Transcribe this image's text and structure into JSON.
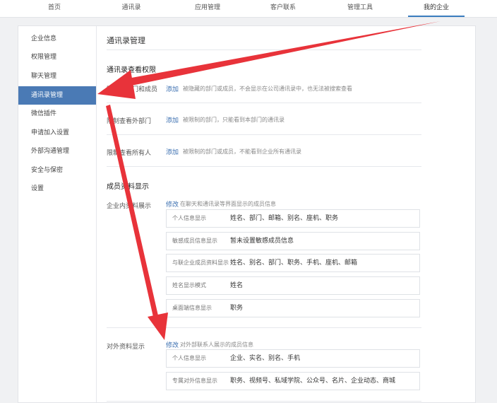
{
  "topnav": [
    "首页",
    "通讯录",
    "应用管理",
    "客户联系",
    "管理工具",
    "我的企业"
  ],
  "sidebar": [
    "企业信息",
    "权限管理",
    "聊天管理",
    "通讯录管理",
    "微信插件",
    "申请加入设置",
    "外部沟通管理",
    "安全与保密",
    "设置"
  ],
  "main": {
    "title": "通讯录管理",
    "view_perm": {
      "title": "通讯录查看权限",
      "rows": [
        {
          "label": "隐藏的部门和成员",
          "link": "添加",
          "desc": "被隐藏的部门或成员，不会显示在公司通讯录中，也无法被搜索查看"
        },
        {
          "label": "限制查看外部门",
          "link": "添加",
          "desc": "被限制的部门，只能看到本部门的通讯录"
        },
        {
          "label": "限制查看所有人",
          "link": "添加",
          "desc": "被限制的部门或成员，不能看到企业所有通讯录"
        }
      ]
    },
    "member_display": {
      "title": "成员资料显示",
      "internal": {
        "label": "企业内资料展示",
        "link": "修改",
        "desc": "在聊天和通讯录等界面显示的成员信息",
        "boxes": [
          {
            "k": "个人信息显示",
            "v": "姓名、部门、邮箱、别名、座机、职务"
          },
          {
            "k": "敏感成员信息显示",
            "v": "暂未设置敏感成员信息"
          },
          {
            "k": "与联企业成员资料显示",
            "v": "姓名、别名、部门、职务、手机、座机、邮箱"
          },
          {
            "k": "姓名显示模式",
            "v": "姓名"
          },
          {
            "k": "桌面端信息显示",
            "v": "职务"
          }
        ]
      },
      "external": {
        "label": "对外资料显示",
        "link": "修改",
        "desc": "对外部联系人展示的成员信息",
        "boxes": [
          {
            "k": "个人信息显示",
            "v": "企业、实名、别名、手机"
          },
          {
            "k": "专属对外信息显示",
            "v": "职务、视频号、私域学院、公众号、名片、企业动态、商城"
          }
        ]
      }
    }
  },
  "colors": {
    "accent": "#4a7ab5",
    "link": "#3b6fb0",
    "arrow": "#e8333a"
  }
}
